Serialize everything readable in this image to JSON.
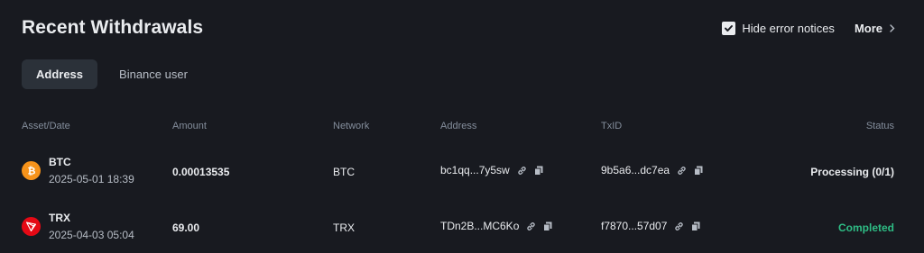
{
  "header": {
    "title": "Recent Withdrawals",
    "hide_errors_label": "Hide error notices",
    "hide_errors_checked": true,
    "more_label": "More"
  },
  "tabs": [
    {
      "label": "Address",
      "active": true
    },
    {
      "label": "Binance user",
      "active": false
    }
  ],
  "table": {
    "columns": [
      "Asset/Date",
      "Amount",
      "Network",
      "Address",
      "TxID",
      "Status"
    ],
    "rows": [
      {
        "asset": "BTC",
        "icon": "btc-icon",
        "date": "2025-05-01 18:39",
        "amount": "0.00013535",
        "network": "BTC",
        "address": "bc1qq...7y5sw",
        "txid": "9b5a6...dc7ea",
        "status": "Processing (0/1)",
        "status_color": "#eaecef"
      },
      {
        "asset": "TRX",
        "icon": "trx-icon",
        "date": "2025-04-03 05:04",
        "amount": "69.00",
        "network": "TRX",
        "address": "TDn2B...MC6Ko",
        "txid": "f7870...57d07",
        "status": "Completed",
        "status_color": "#2ebd85"
      }
    ]
  },
  "colors": {
    "background": "#181a20",
    "active_tab_bg": "#2b3139",
    "btc": "#f7931a",
    "trx": "#e50915",
    "completed": "#2ebd85"
  }
}
